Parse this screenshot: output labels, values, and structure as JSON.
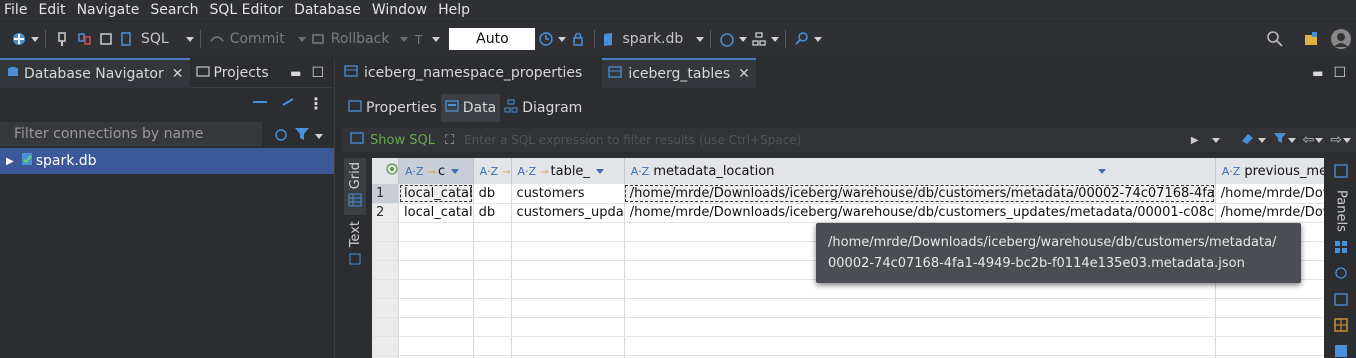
{
  "menu": [
    "File",
    "Edit",
    "Navigate",
    "Search",
    "SQL Editor",
    "Database",
    "Window",
    "Help"
  ],
  "toolbar": {
    "sql_label": "SQL",
    "commit_label": "Commit",
    "rollback_label": "Rollback",
    "mode_value": "Auto",
    "datasource": "spark.db"
  },
  "left_panel": {
    "tabs": [
      "Database Navigator",
      "Projects"
    ],
    "filter_placeholder": "Filter connections by name",
    "tree": [
      {
        "label": "spark.db"
      }
    ]
  },
  "editor": {
    "tabs": [
      "iceberg_namespace_properties",
      "iceberg_tables"
    ],
    "subtabs": [
      "Properties",
      "Data",
      "Diagram"
    ],
    "show_sql": "Show SQL",
    "filter_placeholder": "Enter a SQL expression to filter results (use Ctrl+Space)",
    "vtabs": [
      "Grid",
      "Text"
    ],
    "right_panel_label": "Panels"
  },
  "grid": {
    "columns": [
      "c",
      "",
      "table_",
      "metadata_location",
      "previous_metadata_location"
    ],
    "rows": [
      {
        "n": "1",
        "cells": [
          "local_catal",
          "db",
          "customers",
          "/home/mrde/Downloads/iceberg/warehouse/db/customers/metadata/00002-74c07168-4fa",
          "/home/mrde/Downloads/iceberg/"
        ]
      },
      {
        "n": "2",
        "cells": [
          "local_catal",
          "db",
          "customers_upda",
          "/home/mrde/Downloads/iceberg/warehouse/db/customers_updates/metadata/00001-c08c",
          "/home/mrde/Downloads/iceberg/"
        ]
      }
    ]
  },
  "tooltip": {
    "line1": "/home/mrde/Downloads/iceberg/warehouse/db/customers/metadata/",
    "line2": "00002-74c07168-4fa1-4949-bc2b-f0114e135e03.metadata.json"
  }
}
